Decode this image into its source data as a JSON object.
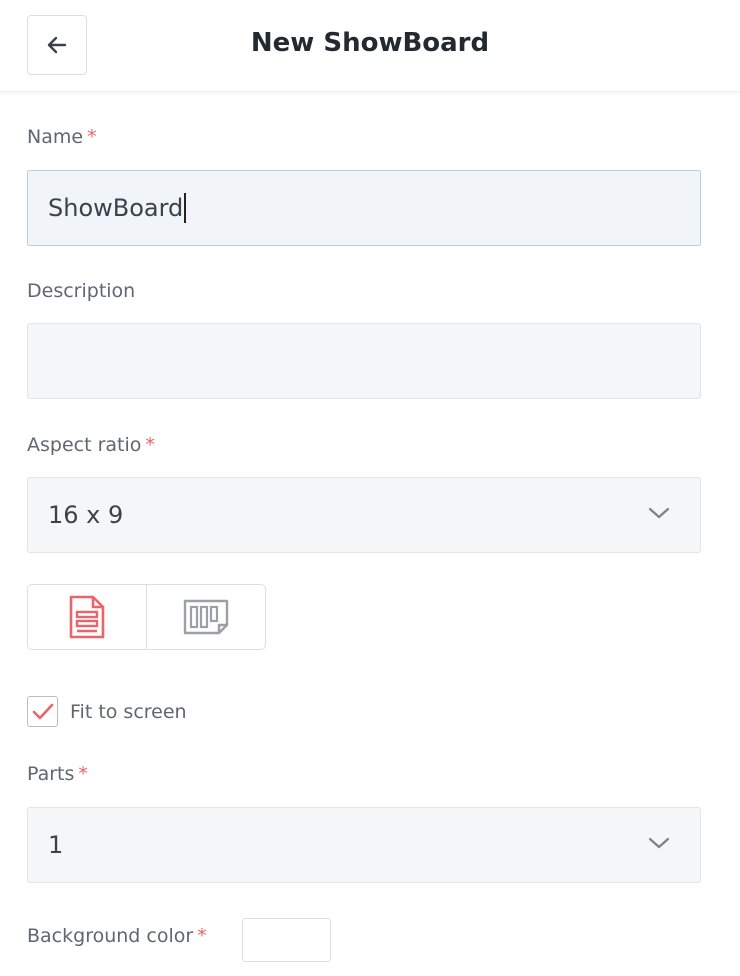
{
  "header": {
    "title": "New ShowBoard",
    "back_icon": "arrow-left-icon"
  },
  "form": {
    "name": {
      "label": "Name",
      "required_mark": "*",
      "value": "ShowBoard"
    },
    "description": {
      "label": "Description",
      "value": ""
    },
    "aspect_ratio": {
      "label": "Aspect ratio",
      "required_mark": "*",
      "value": "16 x 9"
    },
    "layout_toggle": {
      "options": [
        {
          "icon": "document-lines-icon",
          "selected": true
        },
        {
          "icon": "columns-board-icon",
          "selected": false
        }
      ]
    },
    "fit_to_screen": {
      "label": "Fit to screen",
      "checked": true
    },
    "parts": {
      "label": "Parts",
      "required_mark": "*",
      "value": "1"
    },
    "background_color": {
      "label": "Background color",
      "required_mark": "*",
      "value": "#ffffff"
    }
  },
  "colors": {
    "accent": "#e8656a",
    "field_bg": "#f4f6f8",
    "active_border": "#b5cde8"
  }
}
